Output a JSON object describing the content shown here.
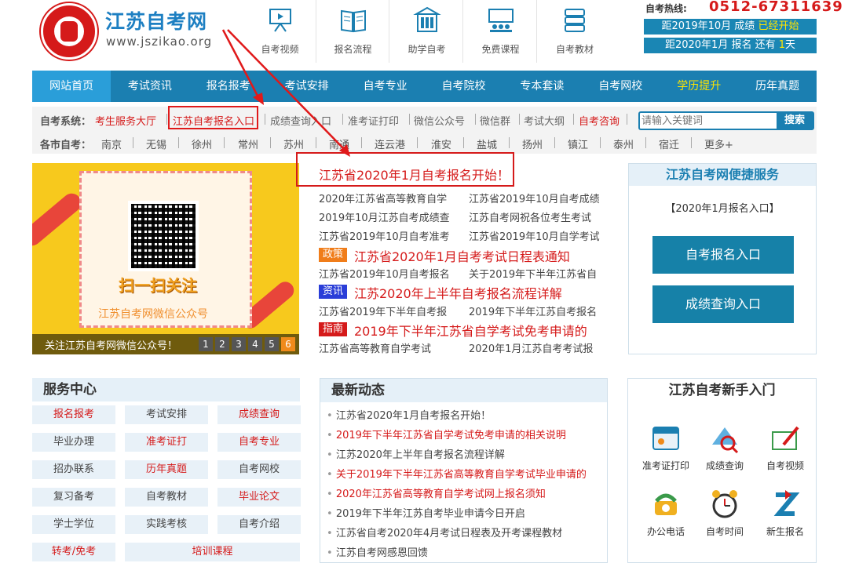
{
  "header": {
    "title": "江苏自考网",
    "url": "www.jszikao.org",
    "nav_icons": [
      {
        "label": "自考视频",
        "icon": "video-board-icon"
      },
      {
        "label": "报名流程",
        "icon": "book-icon"
      },
      {
        "label": "助学自考",
        "icon": "building-icon"
      },
      {
        "label": "免费课程",
        "icon": "classroom-icon"
      },
      {
        "label": "自考教材",
        "icon": "books-stack-icon"
      }
    ],
    "hotline_label": "自考热线:",
    "hotline": "0512-67311639",
    "countdown1_a": "距2019年10月 成绩",
    "countdown1_b": "已经开始",
    "countdown2_a": "距2020年1月 报名 还有",
    "countdown2_n": "1",
    "countdown2_c": "天"
  },
  "mainnav": [
    "网站首页",
    "考试资讯",
    "报名报考",
    "考试安排",
    "自考专业",
    "自考院校",
    "专本套读",
    "自考网校",
    "学历提升",
    "历年真题"
  ],
  "system": {
    "label": "自考系统：",
    "items": [
      "考生服务大厅",
      "江苏自考报名入口",
      "成绩查询入口",
      "准考证打印",
      "微信公众号",
      "微信群",
      "考试大纲",
      "自考咨询"
    ]
  },
  "search": {
    "placeholder": "请输入关键词",
    "button": "搜索"
  },
  "cities": {
    "label": "各市自考：",
    "items": [
      "南京",
      "无锡",
      "徐州",
      "常州",
      "苏州",
      "南通",
      "连云港",
      "淮安",
      "盐城",
      "扬州",
      "镇江",
      "泰州",
      "宿迁",
      "更多+"
    ]
  },
  "banner": {
    "scan_text": "扫一扫关注",
    "wechat_text": "江苏自考网微信公众号",
    "caption": "关注江苏自考网微信公众号！",
    "pages": [
      "1",
      "2",
      "3",
      "4",
      "5",
      "6"
    ]
  },
  "headlines": {
    "top": "江苏省2020年1月自考报名开始！",
    "pairs": [
      [
        "2020年江苏省高等教育自学",
        "江苏省2019年10月自考成绩"
      ],
      [
        "2019年10月江苏自考成绩查",
        "江苏自考网祝各位考生考试"
      ],
      [
        "江苏省2019年10月自考准考",
        "江苏省2019年10月自学考试"
      ]
    ],
    "tag1": "政策",
    "big1": "江苏省2020年1月自考考试日程表通知",
    "pair4": [
      "江苏省2019年10月自考报名",
      "关于2019年下半年江苏省自"
    ],
    "tag2": "资讯",
    "big2": "江苏2020年上半年自考报名流程详解",
    "pair5": [
      "江苏省2019年下半年自考报",
      "2019年下半年江苏自考报名"
    ],
    "tag3": "指南",
    "big3": "2019年下半年江苏省自学考试免考申请的",
    "pair6": [
      "江苏省高等教育自学考试",
      "2020年1月江苏自考考试报"
    ]
  },
  "quick": {
    "title": "江苏自考网便捷服务",
    "sub": "【2020年1月报名入口】",
    "btn1": "自考报名入口",
    "btn2": "成绩查询入口"
  },
  "service": {
    "title": "服务中心",
    "items": [
      "报名报考",
      "考试安排",
      "成绩查询",
      "毕业办理",
      "准考证打",
      "自考专业",
      "招办联系",
      "历年真题",
      "自考网校",
      "复习备考",
      "自考教材",
      "毕业论文",
      "学士学位",
      "实践考核",
      "自考介绍",
      "转考/免考",
      "培训课程"
    ]
  },
  "news": {
    "title": "最新动态",
    "items": [
      "江苏省2020年1月自考报名开始！",
      "2019年下半年江苏省自学考试免考申请的相关说明",
      "江苏2020年上半年自考报名流程详解",
      "关于2019年下半年江苏省高等教育自学考试毕业申请的",
      "2020年江苏省高等教育自学考试网上报名须知",
      "2019年下半年江苏自考毕业申请今日开启",
      "江苏省自考2020年4月考试日程表及开考课程教材",
      "江苏自考网感恩回馈"
    ]
  },
  "newbie": {
    "title": "江苏自考新手入门",
    "items": [
      "准考证打印",
      "成绩查询",
      "自考视频",
      "办公电话",
      "自考时间",
      "新生报名"
    ]
  },
  "colors": {
    "primary": "#1b7fb1",
    "accent_red": "#d51a1a",
    "highlight_yellow": "#ffe500"
  }
}
